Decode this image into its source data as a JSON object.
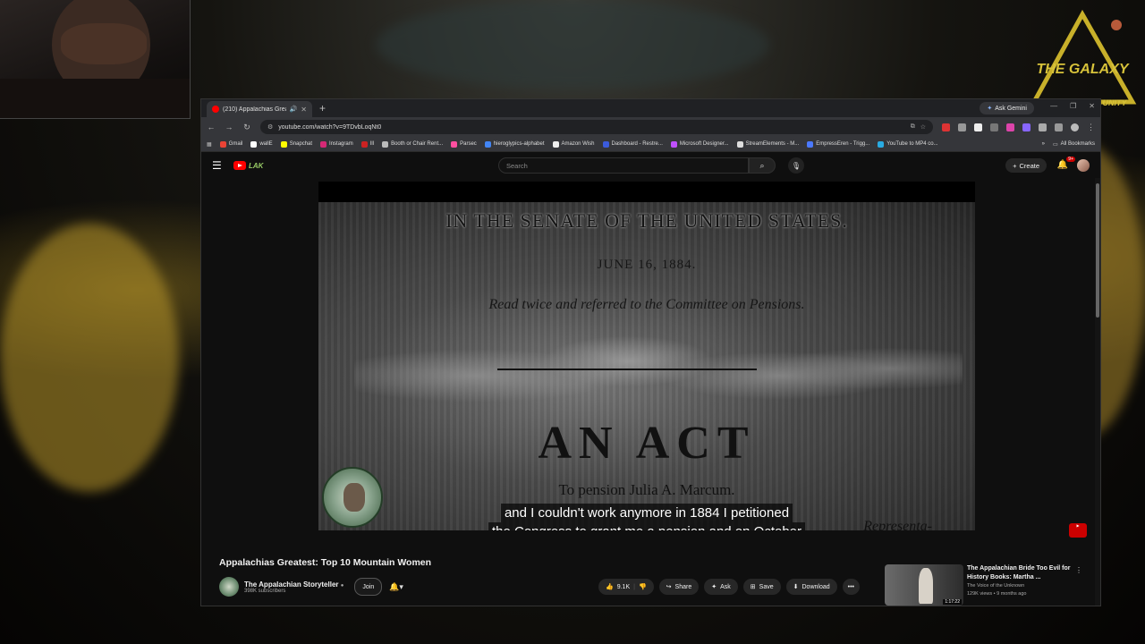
{
  "overlay": {
    "brand_logo_text": "THE GALAXY",
    "brand_logo_sub": "UNITY"
  },
  "browser": {
    "tab_title": "(210) Appalachias Greatest",
    "gemini_label": "Ask Gemini",
    "url": "youtube.com/watch?v=9TDvbLoqNt0",
    "bookmarks": [
      {
        "label": "Gmail",
        "color": "#ea4335"
      },
      {
        "label": "wallE",
        "color": "#ffffff"
      },
      {
        "label": "Snapchat",
        "color": "#fffc00"
      },
      {
        "label": "Instagram",
        "color": "#d62976"
      },
      {
        "label": "Ill",
        "color": "#cc2222"
      },
      {
        "label": "Booth or Chair Rent...",
        "color": "#bbbbbb"
      },
      {
        "label": "Parsec",
        "color": "#ff4fa0"
      },
      {
        "label": "hieroglypics-alphabet",
        "color": "#4285f4"
      },
      {
        "label": "Amazon Wish",
        "color": "#222222"
      },
      {
        "label": "Dashboard - Restre...",
        "color": "#3b5bdb"
      },
      {
        "label": "Microsoft Designer...",
        "color": "#c050ff"
      },
      {
        "label": "StreamElements - M...",
        "color": "#222222"
      },
      {
        "label": "EmpressEren - Trigg...",
        "color": "#4b79ff"
      },
      {
        "label": "YouTube to MP4 co...",
        "color": "#29abe2"
      }
    ],
    "all_bookmarks_label": "All Bookmarks"
  },
  "youtube": {
    "search_placeholder": "Search",
    "create_label": "Create",
    "notif_badge": "9+",
    "logo_doodle": "LAK"
  },
  "video_frame": {
    "line1": "IN THE SENATE OF THE UNITED STATES.",
    "line2": "JUNE 16, 1884.",
    "line3": "Read twice and referred to the Committee on Pensions.",
    "line4": "AN ACT",
    "line5": "To pension Julia A. Marcum.",
    "line6": "Representa-"
  },
  "caption": {
    "line1": "and I couldn't work anymore in 1884 I petitioned",
    "line2": "the Congress to grant me a pension and on October"
  },
  "video_info": {
    "title": "Appalachias Greatest: Top 10 Mountain Women",
    "channel_name": "The Appalachian Storyteller",
    "subscribers": "398K subscribers",
    "join_label": "Join",
    "likes": "9.1K",
    "share_label": "Share",
    "ask_label": "Ask",
    "save_label": "Save",
    "download_label": "Download"
  },
  "related": {
    "title": "The Appalachian Bride Too Evil for History Books: Martha ...",
    "channel": "The Voice of the Unknown",
    "meta": "129K views • 9 months ago",
    "duration": "1:17:22"
  },
  "colors": {
    "youtube_red": "#ff0000",
    "background_dark": "#0f0f0f",
    "chrome_toolbar": "#35363a"
  }
}
